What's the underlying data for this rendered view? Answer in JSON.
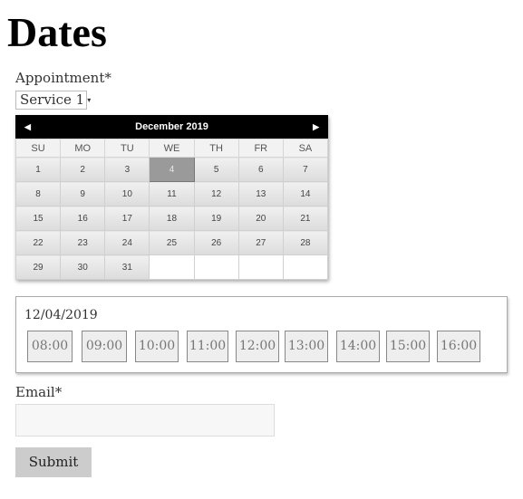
{
  "page": {
    "title": "Dates"
  },
  "appointment": {
    "label": "Appointment*",
    "selected": "Service 1",
    "caret": "▾"
  },
  "calendar": {
    "month_label": "December 2019",
    "prev_icon": "◀",
    "next_icon": "▶",
    "weekdays": [
      "SU",
      "MO",
      "TU",
      "WE",
      "TH",
      "FR",
      "SA"
    ],
    "weeks": [
      [
        "1",
        "2",
        "3",
        "4",
        "5",
        "6",
        "7"
      ],
      [
        "8",
        "9",
        "10",
        "11",
        "12",
        "13",
        "14"
      ],
      [
        "15",
        "16",
        "17",
        "18",
        "19",
        "20",
        "21"
      ],
      [
        "22",
        "23",
        "24",
        "25",
        "26",
        "27",
        "28"
      ],
      [
        "29",
        "30",
        "31",
        "",
        "",
        "",
        ""
      ]
    ],
    "selected_day": "4"
  },
  "timeslots": {
    "date": "12/04/2019",
    "slots": [
      "08:00",
      "09:00",
      "10:00",
      "11:00",
      "12:00",
      "13:00",
      "14:00",
      "15:00",
      "16:00"
    ]
  },
  "email": {
    "label": "Email*",
    "value": "",
    "placeholder": ""
  },
  "submit": {
    "label": "Submit"
  }
}
